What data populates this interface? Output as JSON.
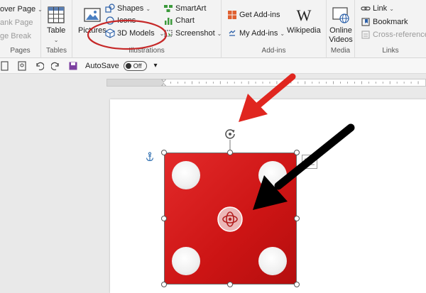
{
  "ribbon": {
    "pages": {
      "cover_page": "over Page",
      "blank_page": "ank Page",
      "page_break": "ge Break",
      "label": "Pages"
    },
    "tables": {
      "table": "Table",
      "label": "Tables"
    },
    "illustrations": {
      "pictures": "Pictures",
      "shapes": "Shapes",
      "icons": "Icons",
      "models_3d": "3D Models",
      "smartart": "SmartArt",
      "chart": "Chart",
      "screenshot": "Screenshot",
      "label": "Illustrations"
    },
    "addins": {
      "get_addins": "Get Add-ins",
      "my_addins": "My Add-ins",
      "wikipedia": "Wikipedia",
      "label": "Add-ins"
    },
    "media": {
      "online_videos_line1": "Online",
      "online_videos_line2": "Videos",
      "label": "Media"
    },
    "links": {
      "link": "Link",
      "bookmark": "Bookmark",
      "cross_reference": "Cross-reference",
      "label": "Links"
    }
  },
  "qat": {
    "autosave_label": "AutoSave",
    "autosave_state": "Off"
  },
  "colors": {
    "model_red": "#d61f1f",
    "annotation_red": "#e0261f",
    "annotation_black": "#000000",
    "highlight_circle": "#c62828"
  },
  "icons": [
    "table-icon",
    "pictures-icon",
    "shapes-icon",
    "icons-icon",
    "3d-models-icon",
    "smartart-icon",
    "chart-icon",
    "screenshot-icon",
    "store-icon",
    "my-addins-icon",
    "wikipedia-icon",
    "online-video-icon",
    "link-icon",
    "bookmark-icon",
    "cross-reference-icon",
    "rotate-icon",
    "anchor-icon",
    "layout-options-icon",
    "3d-rotate-icon"
  ]
}
